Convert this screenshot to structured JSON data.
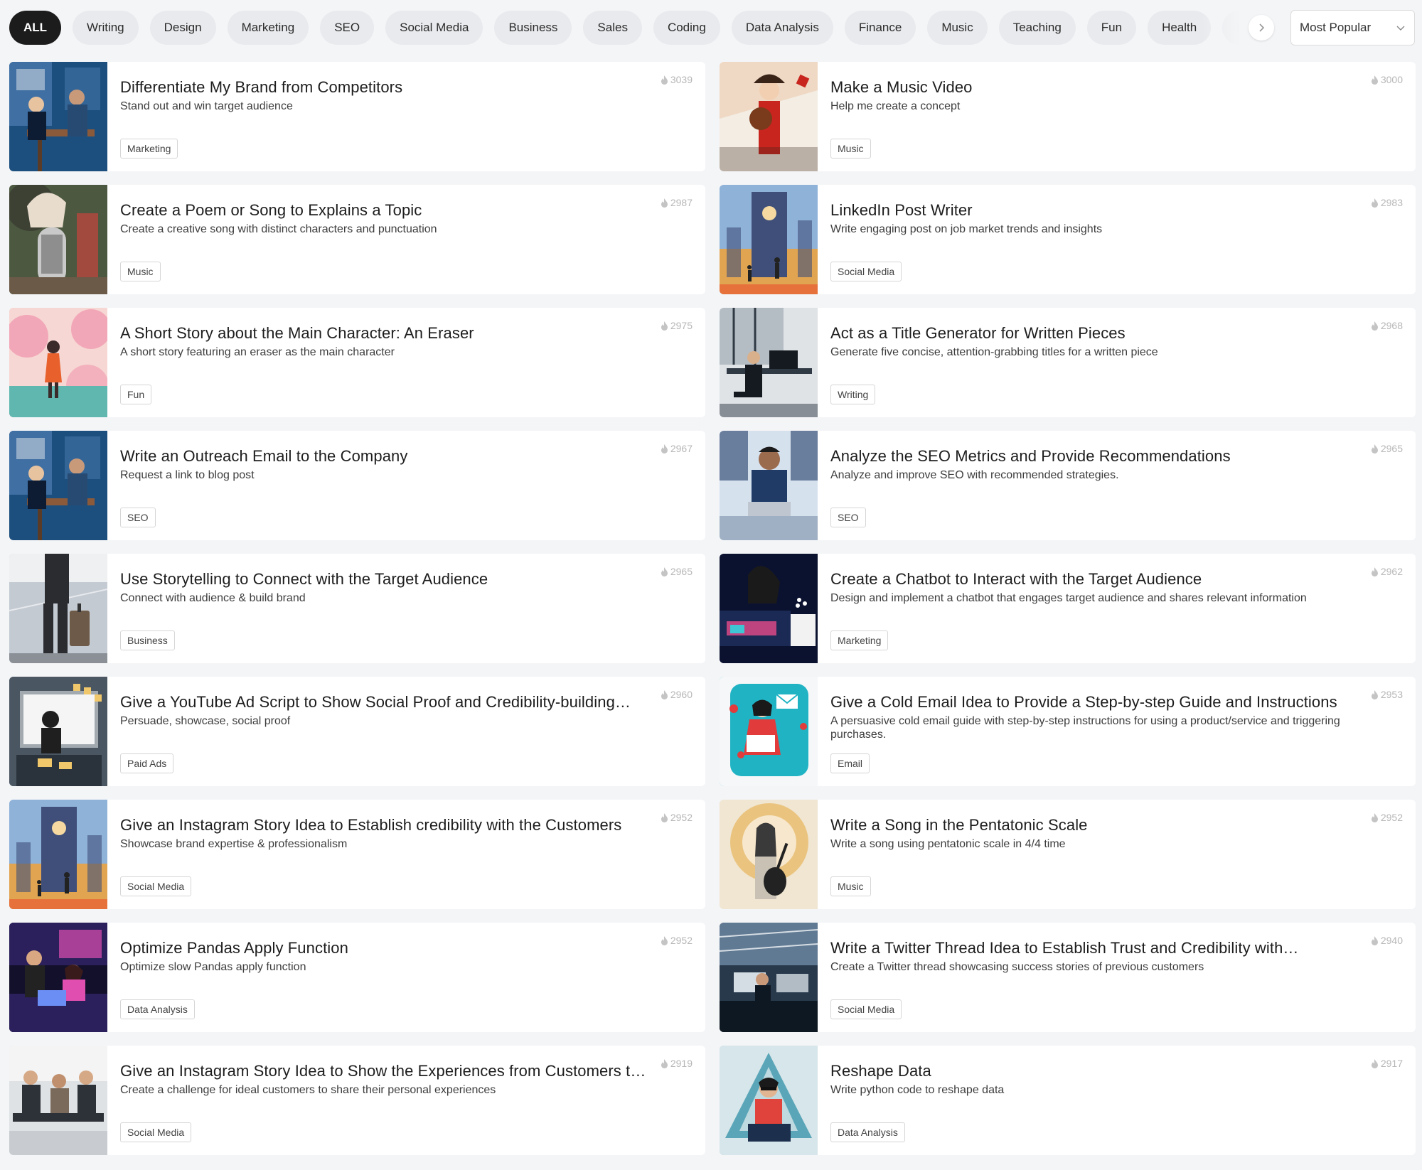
{
  "filters": {
    "categories": [
      "ALL",
      "Writing",
      "Design",
      "Marketing",
      "SEO",
      "Social Media",
      "Business",
      "Sales",
      "Coding",
      "Data Analysis",
      "Finance",
      "Music",
      "Teaching",
      "Fun",
      "Health",
      "Lar"
    ],
    "active": "ALL",
    "sort_label": "Most Popular"
  },
  "cards": [
    {
      "title": "Differentiate My Brand from Competitors",
      "desc": "Stand out and win target audience",
      "tag": "Marketing",
      "count": "3039",
      "scene": "office",
      "colors": [
        "#1d4f7e",
        "#3f6fa3",
        "#0d1c33",
        "#c9d4df"
      ]
    },
    {
      "title": "Make a Music Video",
      "desc": "Help me create a concept",
      "tag": "Music",
      "count": "3000",
      "scene": "musician",
      "colors": [
        "#f3ede4",
        "#c8251f",
        "#3a2418",
        "#e7b58a"
      ]
    },
    {
      "title": "Create a Poem or Song to Explains a Topic",
      "desc": "Create a creative song with distinct characters and punctuation",
      "tag": "Music",
      "count": "2987",
      "scene": "mic",
      "colors": [
        "#4c5840",
        "#b7473c",
        "#e8dccd",
        "#2d2a27"
      ]
    },
    {
      "title": "LinkedIn Post Writer",
      "desc": "Write engaging post on job market trends and insights",
      "tag": "Social Media",
      "count": "2983",
      "scene": "tower",
      "colors": [
        "#8fb2d9",
        "#f0a23a",
        "#3f4f7a",
        "#f5d9a0"
      ]
    },
    {
      "title": "A Short Story about the Main Character: An Eraser",
      "desc": "A short story featuring an eraser as the main character",
      "tag": "Fun",
      "count": "2975",
      "scene": "garden",
      "colors": [
        "#f2a7b8",
        "#5fb7b0",
        "#e8602c",
        "#f6d7d3"
      ]
    },
    {
      "title": "Act as a Title Generator for Written Pieces",
      "desc": "Generate five concise, attention-grabbing titles for a written piece",
      "tag": "Writing",
      "count": "2968",
      "scene": "desk",
      "colors": [
        "#dfe3e6",
        "#2f3a45",
        "#8b97a2",
        "#141a20"
      ]
    },
    {
      "title": "Write an Outreach Email to the Company",
      "desc": "Request a link to blog post",
      "tag": "SEO",
      "count": "2967",
      "scene": "office",
      "colors": [
        "#1d4f7e",
        "#3f6fa3",
        "#0d1c33",
        "#c9d4df"
      ]
    },
    {
      "title": "Analyze the SEO Metrics and Provide Recommendations",
      "desc": "Analyze and improve SEO with recommended strategies.",
      "tag": "SEO",
      "count": "2965",
      "scene": "laptop",
      "colors": [
        "#d6e1ee",
        "#1f3b66",
        "#e9eef4",
        "#9b6b4e"
      ]
    },
    {
      "title": "Use Storytelling to Connect with the Target Audience",
      "desc": "Connect with audience & build brand",
      "tag": "Business",
      "count": "2965",
      "scene": "traveler",
      "colors": [
        "#c3cad2",
        "#2a2c30",
        "#6e5a48",
        "#eef0f2"
      ]
    },
    {
      "title": "Create a Chatbot to Interact with the Target Audience",
      "desc": "Design and implement a chatbot that engages target audience and shares relevant information",
      "tag": "Marketing",
      "count": "2962",
      "scene": "screen",
      "colors": [
        "#1b2a55",
        "#e64b8a",
        "#3ec6d4",
        "#0b1230"
      ]
    },
    {
      "title": "Give a YouTube Ad Script to Show Social Proof and Credibility-building…",
      "desc": "Persuade, showcase, social proof",
      "tag": "Paid Ads",
      "count": "2960",
      "scene": "notes",
      "colors": [
        "#4a5763",
        "#f0c76a",
        "#2a333c",
        "#c7cdd2"
      ]
    },
    {
      "title": "Give a Cold Email Idea to Provide a Step-by-step Guide and Instructions",
      "desc": "A persuasive cold email guide with step-by-step instructions for using a product/service and triggering purchases.",
      "tag": "Email",
      "count": "2953",
      "scene": "email",
      "colors": [
        "#20b3c4",
        "#e23b3b",
        "#ffffff",
        "#0f3d57"
      ]
    },
    {
      "title": "Give an Instagram Story Idea to Establish credibility with the Customers",
      "desc": "Showcase brand expertise & professionalism",
      "tag": "Social Media",
      "count": "2952",
      "scene": "tower",
      "colors": [
        "#8fb2d9",
        "#f0a23a",
        "#3f4f7a",
        "#f5d9a0"
      ]
    },
    {
      "title": "Write a Song in the Pentatonic Scale",
      "desc": "Write a song using pentatonic scale in 4/4 time",
      "tag": "Music",
      "count": "2952",
      "scene": "guitar",
      "colors": [
        "#f0e6d2",
        "#e5a83a",
        "#3b3a3a",
        "#c9c2b4"
      ]
    },
    {
      "title": "Optimize Pandas Apply Function",
      "desc": "Optimize slow Pandas apply function",
      "tag": "Data Analysis",
      "count": "2952",
      "scene": "neon",
      "colors": [
        "#2b1f5c",
        "#e04fb0",
        "#6b8ef5",
        "#12102b"
      ]
    },
    {
      "title": "Write a Twitter Thread Idea to Establish Trust and Credibility with…",
      "desc": "Create a Twitter thread showcasing success stories of previous customers",
      "tag": "Social Media",
      "count": "2940",
      "scene": "workspace",
      "colors": [
        "#28394b",
        "#8fb1cf",
        "#0e1822",
        "#d5dde4"
      ]
    },
    {
      "title": "Give an Instagram Story Idea to Show the Experiences from Customers to…",
      "desc": "Create a challenge for ideal customers to share their personal experiences",
      "tag": "Social Media",
      "count": "2919",
      "scene": "meeting",
      "colors": [
        "#dfe2e5",
        "#2d3238",
        "#7a6a5b",
        "#f4f4f4"
      ]
    },
    {
      "title": "Reshape Data",
      "desc": "Write python code to reshape data",
      "tag": "Data Analysis",
      "count": "2917",
      "scene": "coder",
      "colors": [
        "#5aa6b8",
        "#1c2f4d",
        "#e0433b",
        "#d7e6ea"
      ]
    }
  ]
}
